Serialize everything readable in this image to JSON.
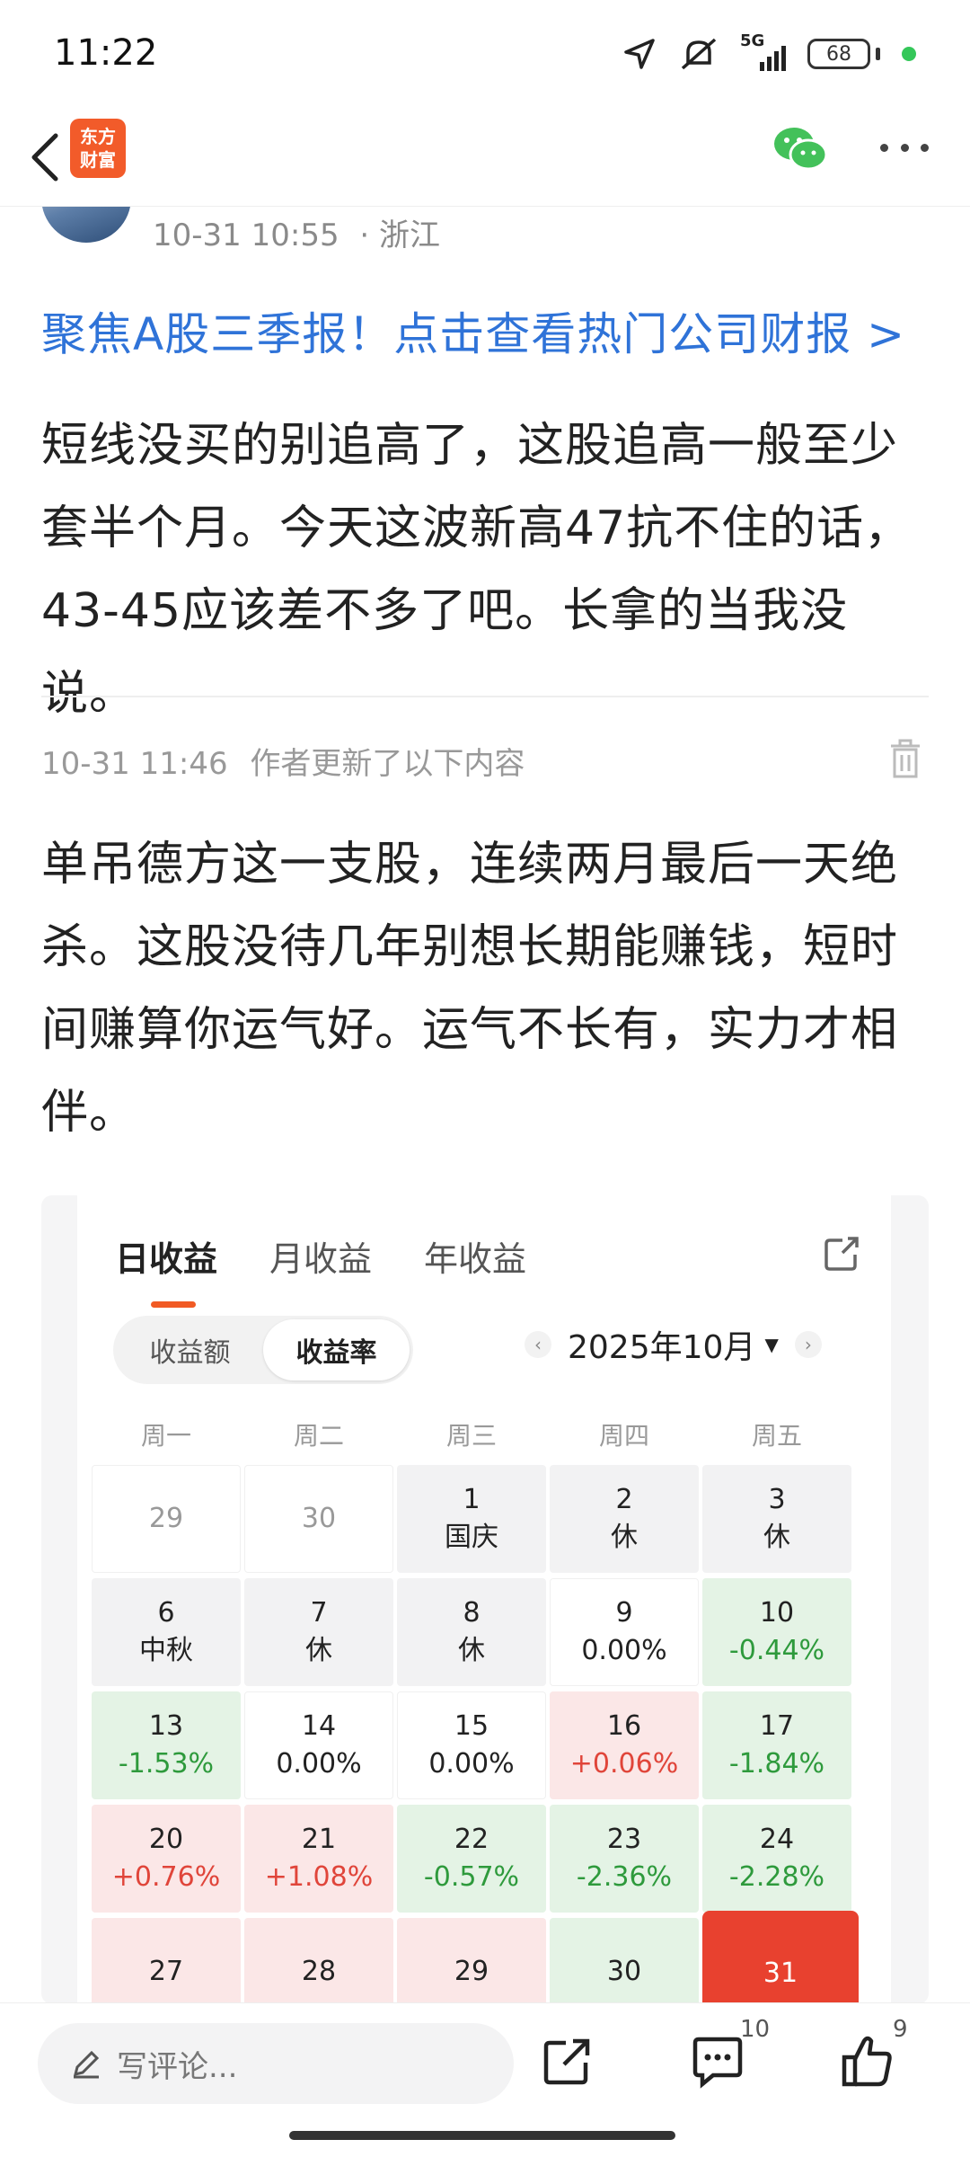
{
  "status_bar": {
    "time": "11:22",
    "network": "5G",
    "battery": "68"
  },
  "header": {
    "logo_line1": "东方",
    "logo_line2": "财富"
  },
  "post": {
    "timestamp": "10-31 10:55",
    "location": "· 浙江",
    "promo_link": "聚焦A股三季报！点击查看热门公司财报 >",
    "body": "短线没买的别追高了，这股追高一般至少套半个月。今天这波新高47抗不住的话，43-45应该差不多了吧。长拿的当我没说。",
    "update_time": "10-31 11:46",
    "update_label": "作者更新了以下内容",
    "update_body": "单吊德方这一支股，连续两月最后一天绝杀。这股没待几年别想长期能赚钱，短时间赚算你运气好。运气不长有，实力才相伴。"
  },
  "calendar": {
    "tabs": [
      "日收益",
      "月收益",
      "年收益"
    ],
    "segments": [
      "收益额",
      "收益率"
    ],
    "month": "2025年10月",
    "weekdays": [
      "周一",
      "周二",
      "周三",
      "周四",
      "周五"
    ],
    "cells": [
      {
        "day": "29",
        "sub": "",
        "style": "outside"
      },
      {
        "day": "30",
        "sub": "",
        "style": "outside"
      },
      {
        "day": "1",
        "sub": "国庆",
        "style": "gray"
      },
      {
        "day": "2",
        "sub": "休",
        "style": "gray"
      },
      {
        "day": "3",
        "sub": "休",
        "style": "gray"
      },
      {
        "day": "6",
        "sub": "中秋",
        "style": "gray"
      },
      {
        "day": "7",
        "sub": "休",
        "style": "gray"
      },
      {
        "day": "8",
        "sub": "休",
        "style": "gray"
      },
      {
        "day": "9",
        "sub": "0.00%",
        "style": "white"
      },
      {
        "day": "10",
        "sub": "-0.44%",
        "style": "green"
      },
      {
        "day": "13",
        "sub": "-1.53%",
        "style": "green"
      },
      {
        "day": "14",
        "sub": "0.00%",
        "style": "white"
      },
      {
        "day": "15",
        "sub": "0.00%",
        "style": "white"
      },
      {
        "day": "16",
        "sub": "+0.06%",
        "style": "red"
      },
      {
        "day": "17",
        "sub": "-1.84%",
        "style": "green"
      },
      {
        "day": "20",
        "sub": "+0.76%",
        "style": "red"
      },
      {
        "day": "21",
        "sub": "+1.08%",
        "style": "red"
      },
      {
        "day": "22",
        "sub": "-0.57%",
        "style": "green"
      },
      {
        "day": "23",
        "sub": "-2.36%",
        "style": "green"
      },
      {
        "day": "24",
        "sub": "-2.28%",
        "style": "green"
      },
      {
        "day": "27",
        "sub": "",
        "style": "red"
      },
      {
        "day": "28",
        "sub": "",
        "style": "red"
      },
      {
        "day": "29",
        "sub": "",
        "style": "red"
      },
      {
        "day": "30",
        "sub": "",
        "style": "green"
      },
      {
        "day": "31",
        "sub": "",
        "style": "today"
      }
    ]
  },
  "bottom_bar": {
    "comment_placeholder": "写评论...",
    "comment_count": "10",
    "like_count": "9"
  },
  "colors": {
    "link_blue": "#2f73d8",
    "brand_orange": "#f25b2a",
    "gain_red": "#e0453a",
    "loss_green": "#2e9a3c"
  }
}
